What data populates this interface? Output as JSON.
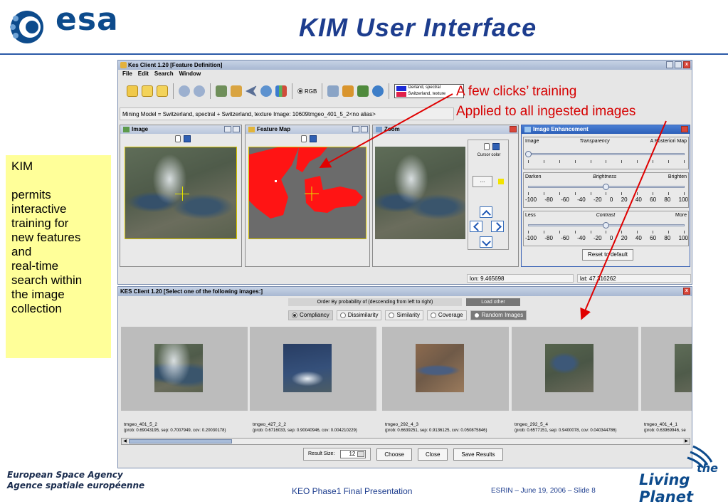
{
  "slide": {
    "logo_text": "esa",
    "title": "KIM  User  Interface",
    "callout_lines": [
      "KIM",
      "",
      "permits",
      "interactive",
      "training for",
      "new features",
      "and",
      "real-time",
      "search within",
      "the image",
      "collection"
    ],
    "annotations": [
      "A few clicks’ training",
      "Applied to all ingested images"
    ],
    "footer": {
      "agency_en": "European Space Agency",
      "agency_fr": "Agence spatiale européenne",
      "presentation": "KEO Phase1 Final Presentation",
      "date_slide": "ESRIN – June 19, 2006 – Slide 8",
      "living_the": "the",
      "living_planet": "Living Planet"
    },
    "colors": {
      "esa_blue": "#0d4b8c",
      "title_blue": "#1d3d8e",
      "annotation_red": "#d60000",
      "callout_yellow": "#ffff99",
      "feature_red": "#ff1414"
    }
  },
  "app": {
    "title": "Kes Client 1.20 [Feature Definition]",
    "menu": [
      "File",
      "Edit",
      "Search",
      "Window"
    ],
    "toolbar": {
      "rgb_label": "RGB",
      "model_chip": [
        "tzerland, spectral",
        "Switzerland, texture"
      ],
      "icons": [
        "open-icon",
        "folder-icon",
        "folder-icon",
        "undo-icon",
        "redo-icon",
        "train-icon",
        "clear-icon",
        "back-icon",
        "search-icon",
        "chart-icon",
        "tools-icon",
        "pencil-icon",
        "filter-icon",
        "globe-icon"
      ]
    },
    "status": "Mining Model = Switzerland, spectral + Switzerland, texture    Image: 10609tmgeo_401_5_2<no alias>",
    "panels": {
      "image": "Image",
      "feature_map": "Feature Map",
      "zoom": "Zoom",
      "enhancement": "Image Enhancement"
    },
    "zoom": {
      "cursor_color": "Cursor color",
      "cursor_btn": "..."
    },
    "enhancement": {
      "transparency": {
        "left": "Image",
        "mid": "Transparency",
        "right": "A Posteriori Map"
      },
      "brightness": {
        "left": "Darken",
        "mid": "Brightness",
        "right": "Brighten"
      },
      "contrast": {
        "left": "Less",
        "mid": "Contrast",
        "right": "More"
      },
      "scale": [
        "-100",
        "-80",
        "-60",
        "-40",
        "-20",
        "0",
        "20",
        "40",
        "60",
        "80",
        "100"
      ],
      "reset": "Reset to default"
    },
    "coords": {
      "lon": "lon: 9.465698",
      "lat": "lat: 47.316262"
    }
  },
  "results": {
    "title": "KES Client 1.20 [Select one of the following images:]",
    "order_label": "Order By probability of (descending from left to right)",
    "load_other": "Load other",
    "options": [
      "Compliancy",
      "Dissimilarity",
      "Similarity",
      "Coverage",
      "Random Images"
    ],
    "selected_option": "Compliancy",
    "thumbnails": [
      {
        "name": "tmgeo_401_5_2",
        "meta": "(prob: 0.69043195, sep: 0.7007949, cov: 0.20030178)"
      },
      {
        "name": "tmgeo_427_2_2",
        "meta": "(prob: 0.6716033, sep: 0.90040946, cov: 0.004210229)"
      },
      {
        "name": "tmgeo_292_4_3",
        "meta": "(prob: 0.6639251, sep: 0.9136125, cov: 0.050875846)"
      },
      {
        "name": "tmgeo_292_5_4",
        "meta": "(prob: 0.6577151, sep: 0.9400078, cov: 0.040344786)"
      },
      {
        "name": "tmgeo_401_4_1",
        "meta": "(prob: 0.63969946, se"
      }
    ],
    "result_size_label": "Result Size:",
    "result_size_value": "12",
    "buttons": {
      "choose": "Choose",
      "close": "Close",
      "save": "Save Results"
    }
  }
}
